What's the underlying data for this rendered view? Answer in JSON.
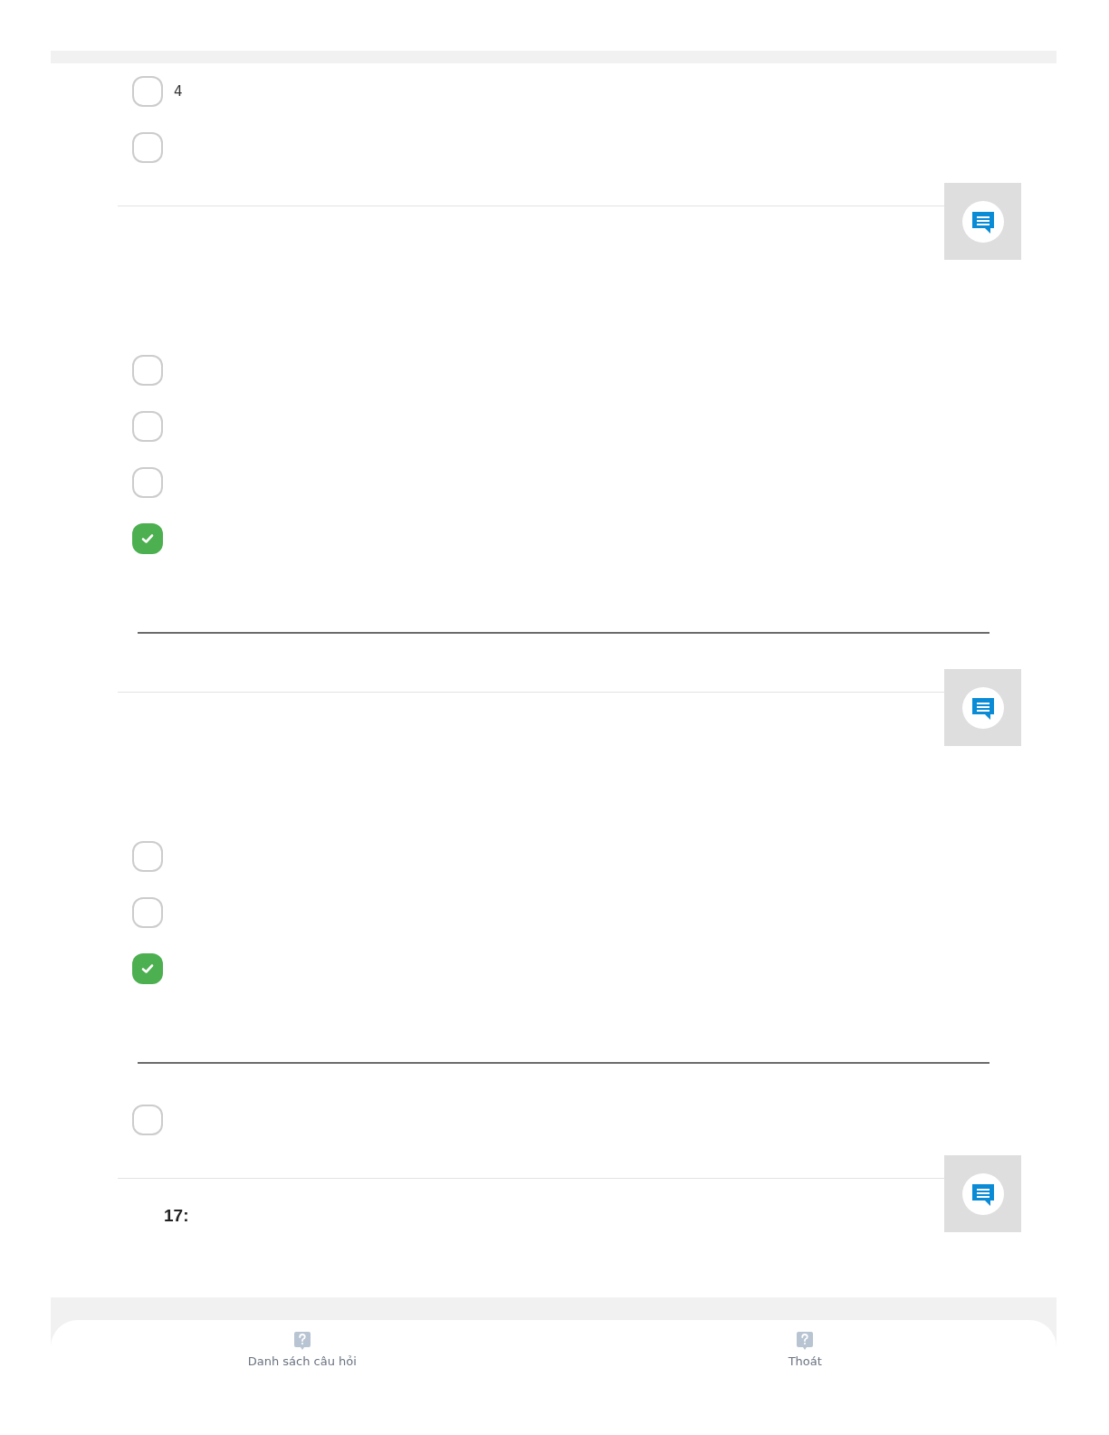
{
  "blocks": [
    {
      "comment_button": false,
      "items": [
        {
          "kind": "option",
          "label": "4",
          "checked": false
        },
        {
          "kind": "option",
          "checked": false
        }
      ]
    },
    {
      "comment_button": true,
      "items": [
        {
          "kind": "option",
          "checked": false
        },
        {
          "kind": "option",
          "checked": false
        },
        {
          "kind": "option",
          "checked": false
        },
        {
          "kind": "option",
          "checked": true
        },
        {
          "kind": "rule"
        }
      ]
    },
    {
      "comment_button": true,
      "items": [
        {
          "kind": "option",
          "checked": false
        },
        {
          "kind": "option",
          "checked": false
        },
        {
          "kind": "option",
          "checked": true
        },
        {
          "kind": "rule"
        },
        {
          "kind": "option",
          "checked": false
        }
      ]
    },
    {
      "comment_button": true,
      "number": "17:"
    }
  ],
  "bottom_nav": [
    {
      "label": "Danh sách câu hỏi"
    },
    {
      "label": "Thoát"
    }
  ]
}
